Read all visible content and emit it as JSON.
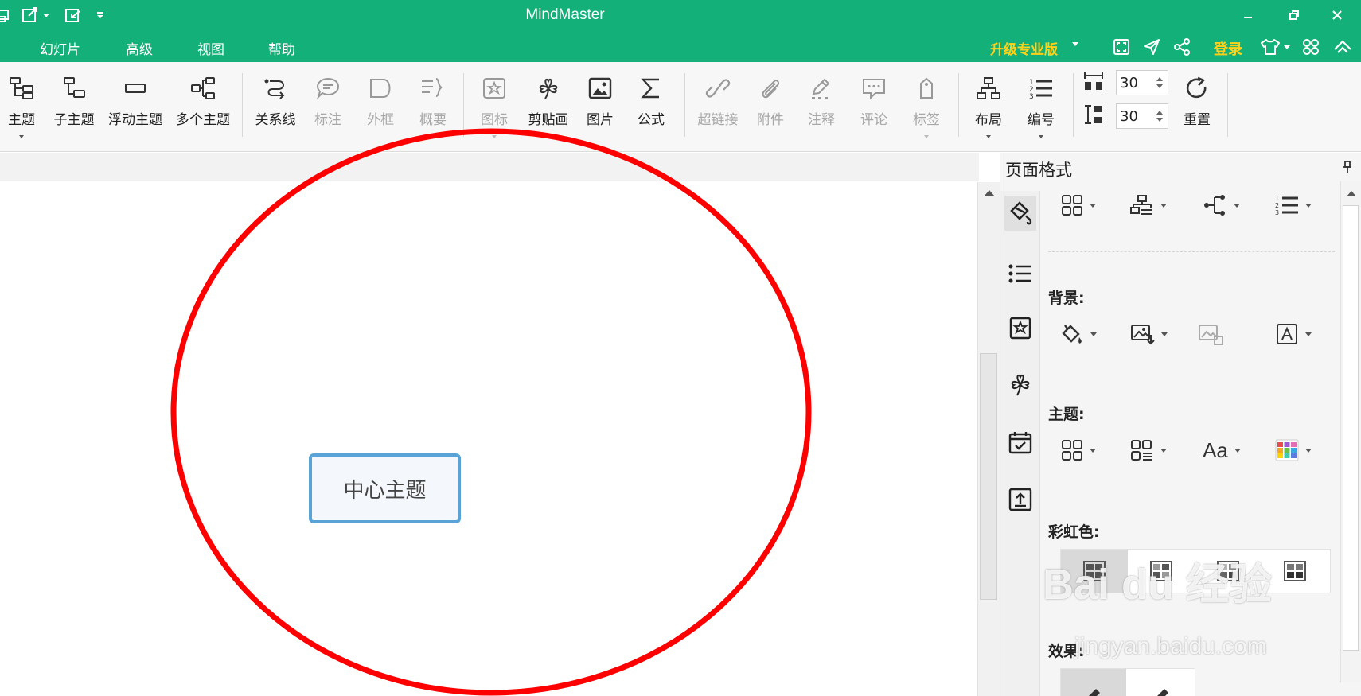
{
  "titlebar": {
    "app_title": "MindMaster"
  },
  "menu": {
    "items": [
      "幻灯片",
      "高级",
      "视图",
      "帮助"
    ],
    "upgrade_label": "升级专业版",
    "login_label": "登录"
  },
  "ribbon": {
    "tools": [
      {
        "label": "主题",
        "icon": "topic-icon",
        "enabled": true,
        "dropdown": true
      },
      {
        "label": "子主题",
        "icon": "subtopic-icon",
        "enabled": true
      },
      {
        "label": "浮动主题",
        "icon": "floating-topic-icon",
        "enabled": true
      },
      {
        "label": "多个主题",
        "icon": "multiple-topics-icon",
        "enabled": true
      },
      {
        "label": "关系线",
        "icon": "relationship-icon",
        "enabled": true
      },
      {
        "label": "标注",
        "icon": "callout-icon",
        "enabled": false
      },
      {
        "label": "外框",
        "icon": "boundary-icon",
        "enabled": false
      },
      {
        "label": "概要",
        "icon": "summary-icon",
        "enabled": false
      },
      {
        "label": "图标",
        "icon": "mark-icon",
        "enabled": false,
        "dropdown": true
      },
      {
        "label": "剪贴画",
        "icon": "clipart-icon",
        "enabled": true
      },
      {
        "label": "图片",
        "icon": "picture-icon",
        "enabled": true
      },
      {
        "label": "公式",
        "icon": "formula-icon",
        "enabled": true
      },
      {
        "label": "超链接",
        "icon": "hyperlink-icon",
        "enabled": false
      },
      {
        "label": "附件",
        "icon": "attachment-icon",
        "enabled": false
      },
      {
        "label": "注释",
        "icon": "note-icon",
        "enabled": false
      },
      {
        "label": "评论",
        "icon": "comment-icon",
        "enabled": false
      },
      {
        "label": "标签",
        "icon": "tag-icon",
        "enabled": false,
        "dropdown": true
      },
      {
        "label": "布局",
        "icon": "layout-icon",
        "enabled": true,
        "dropdown": true
      },
      {
        "label": "编号",
        "icon": "numbering-icon",
        "enabled": true,
        "dropdown": true
      },
      {
        "label": "重置",
        "icon": "reset-icon",
        "enabled": true
      }
    ],
    "spacing_h": "30",
    "spacing_v": "30"
  },
  "canvas": {
    "central_topic": "中心主题",
    "annotation_color": "#ff0000"
  },
  "panel": {
    "title": "页面格式",
    "sections": {
      "background": "背景:",
      "theme": "主题:",
      "rainbow": "彩虹色:",
      "effect": "效果:"
    }
  },
  "colors": {
    "brand": "#14b07a",
    "accent_gold": "#ffd11a",
    "topic_border": "#5aa3d6"
  },
  "watermark": {
    "main": "Bai du 经验",
    "sub": "jingyan.baidu.com"
  }
}
